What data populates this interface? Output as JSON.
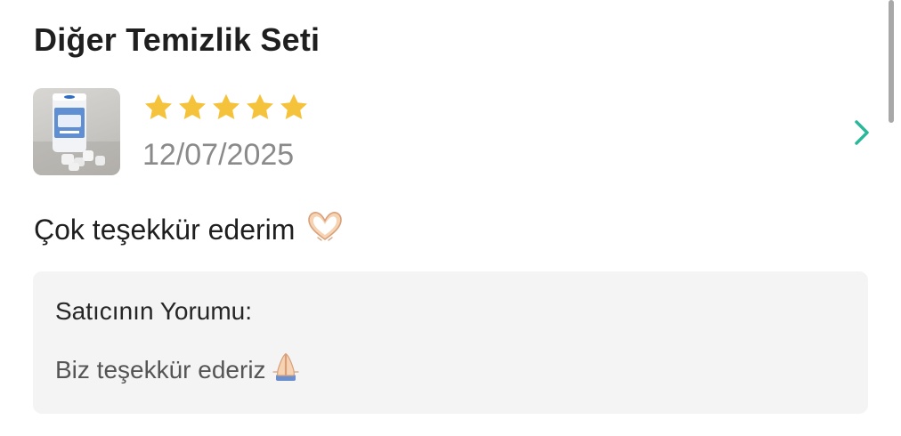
{
  "review": {
    "product_name": "Diğer Temizlik Seti",
    "rating": 5,
    "rating_max": 5,
    "date": "12/07/2025",
    "comment": "Çok teşekkür ederim",
    "comment_emoji": "heart-hands-icon"
  },
  "seller": {
    "label": "Satıcının Yorumu:",
    "reply": "Biz teşekkür ederiz",
    "reply_emoji": "folded-hands-icon"
  },
  "colors": {
    "star": "#F5C33B",
    "chevron": "#2BB89A",
    "seller_box_bg": "#F4F4F4",
    "date_text": "#8A8A8A"
  }
}
